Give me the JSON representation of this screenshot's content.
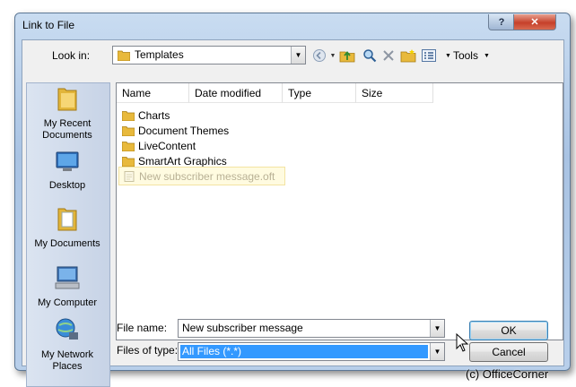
{
  "window": {
    "title": "Link to File",
    "help_label": "?",
    "close_label": "✕"
  },
  "toolbar": {
    "look_in_label": "Look in:",
    "look_in_value": "Templates",
    "tools_label": "Tools"
  },
  "places": [
    {
      "label": "My Recent Documents"
    },
    {
      "label": "Desktop"
    },
    {
      "label": "My Documents"
    },
    {
      "label": "My Computer"
    },
    {
      "label": "My Network Places"
    }
  ],
  "columns": [
    "Name",
    "Date modified",
    "Type",
    "Size"
  ],
  "items": [
    {
      "name": "Charts"
    },
    {
      "name": "Document Themes"
    },
    {
      "name": "LiveContent"
    },
    {
      "name": "SmartArt Graphics"
    },
    {
      "name": "New subscriber message.oft"
    }
  ],
  "form": {
    "file_name_label": "File name:",
    "file_name_value": "New subscriber message",
    "file_type_label": "Files of type:",
    "file_type_value": "All Files (*.*)",
    "ok_label": "OK",
    "cancel_label": "Cancel"
  },
  "watermark": "(c) OfficeCorner"
}
